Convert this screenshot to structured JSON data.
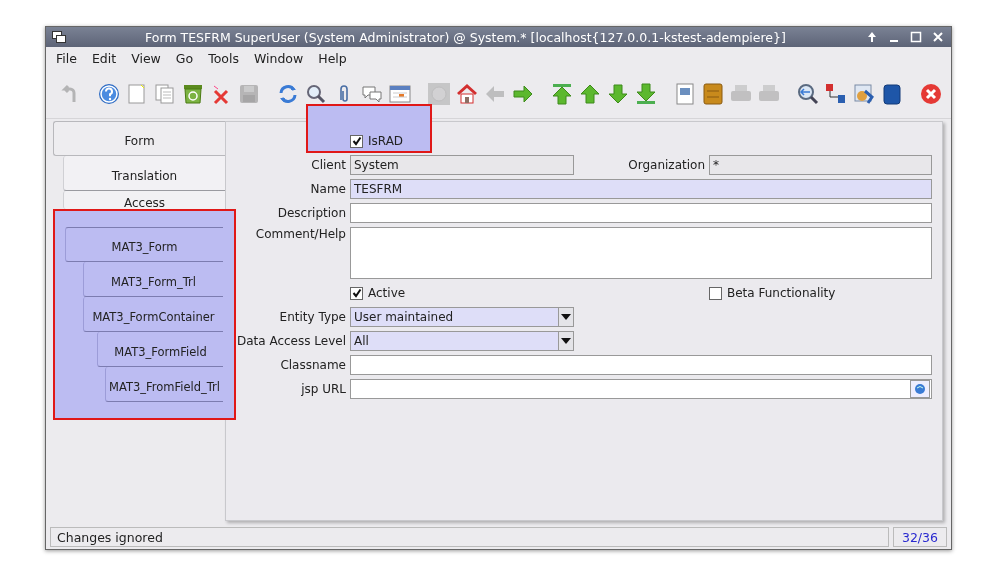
{
  "window": {
    "title": "Form  TESFRM  SuperUser (System Administrator) @ System.* [localhost{127.0.0.1-kstest-adempiere}]"
  },
  "menu": [
    "File",
    "Edit",
    "View",
    "Go",
    "Tools",
    "Window",
    "Help"
  ],
  "toolbar": [
    {
      "kind": "undo",
      "disabled": true,
      "group_start": false
    },
    {
      "kind": "help",
      "disabled": false,
      "group_start": true
    },
    {
      "kind": "new",
      "disabled": false,
      "group_start": false
    },
    {
      "kind": "copy",
      "disabled": false,
      "group_start": false
    },
    {
      "kind": "recycle",
      "disabled": false,
      "group_start": false
    },
    {
      "kind": "delete",
      "disabled": false,
      "group_start": false
    },
    {
      "kind": "save",
      "disabled": true,
      "group_start": false
    },
    {
      "kind": "refresh",
      "disabled": false,
      "group_start": true
    },
    {
      "kind": "search",
      "disabled": false,
      "group_start": false
    },
    {
      "kind": "attach",
      "disabled": false,
      "group_start": false
    },
    {
      "kind": "chat",
      "disabled": false,
      "group_start": false
    },
    {
      "kind": "calendar",
      "disabled": false,
      "group_start": false
    },
    {
      "kind": "history",
      "disabled": true,
      "group_start": true
    },
    {
      "kind": "home",
      "disabled": false,
      "group_start": false
    },
    {
      "kind": "back",
      "disabled": true,
      "group_start": false
    },
    {
      "kind": "forward",
      "disabled": false,
      "group_start": false
    },
    {
      "kind": "first",
      "disabled": false,
      "group_start": true
    },
    {
      "kind": "up",
      "disabled": false,
      "group_start": false
    },
    {
      "kind": "down",
      "disabled": false,
      "group_start": false
    },
    {
      "kind": "last",
      "disabled": false,
      "group_start": false
    },
    {
      "kind": "report",
      "disabled": false,
      "group_start": true
    },
    {
      "kind": "archive",
      "disabled": false,
      "group_start": false
    },
    {
      "kind": "print",
      "disabled": true,
      "group_start": false
    },
    {
      "kind": "print",
      "disabled": true,
      "group_start": false
    },
    {
      "kind": "zoom",
      "disabled": false,
      "group_start": true
    },
    {
      "kind": "workflow",
      "disabled": false,
      "group_start": false
    },
    {
      "kind": "process",
      "disabled": false,
      "group_start": false
    },
    {
      "kind": "database",
      "disabled": false,
      "group_start": false
    },
    {
      "kind": "close",
      "disabled": false,
      "group_start": true
    }
  ],
  "tabs": [
    {
      "label": "Form",
      "selected": true,
      "highlighted": false,
      "children": [
        {
          "label": "Translation",
          "selected": false,
          "highlighted": false
        },
        {
          "label": "Access",
          "selected": false,
          "highlighted": false
        },
        {
          "label": "MAT3_Form",
          "selected": false,
          "highlighted": true,
          "children": [
            {
              "label": "MAT3_Form_Trl",
              "selected": false,
              "highlighted": false
            },
            {
              "label": "MAT3_FormContainer",
              "selected": false,
              "highlighted": false,
              "children": [
                {
                  "label": "MAT3_FormField",
                  "selected": false,
                  "highlighted": false,
                  "children": [
                    {
                      "label": "MAT3_FromField_Trl",
                      "selected": false,
                      "highlighted": false
                    }
                  ]
                }
              ]
            }
          ]
        }
      ]
    }
  ],
  "form_rows": [
    [
      {
        "kind": "checkbox",
        "label": "IsRAD",
        "checked": true,
        "highlighted": true
      }
    ],
    [
      {
        "kind": "text",
        "label": "Client",
        "value": "System",
        "mandatory": false,
        "readonly": true,
        "wide": false
      },
      {
        "kind": "text",
        "label": "Organization",
        "value": "*",
        "mandatory": false,
        "readonly": true,
        "wide": false
      }
    ],
    [
      {
        "kind": "text",
        "label": "Name",
        "value": "TESFRM",
        "mandatory": true,
        "wide": true
      }
    ],
    [
      {
        "kind": "text",
        "label": "Description",
        "mandatory": false,
        "readonly": false,
        "wide": true
      }
    ],
    [
      {
        "kind": "textarea",
        "label": "Comment/Help",
        "wide": true
      }
    ],
    [
      {
        "kind": "checkbox",
        "label": "Active",
        "checked": true,
        "highlighted": false
      },
      {
        "kind": "checkbox",
        "label": "Beta Functionality",
        "checked": false,
        "highlighted": false
      }
    ],
    [
      {
        "kind": "select",
        "label": "Entity Type",
        "value": "User maintained"
      }
    ],
    [
      {
        "kind": "select",
        "label": "Data Access Level",
        "value": "All"
      }
    ],
    [
      {
        "kind": "text",
        "label": "Classname",
        "mandatory": false,
        "readonly": false,
        "wide": true
      }
    ],
    [
      {
        "kind": "url",
        "label": "jsp URL",
        "wide": true
      }
    ]
  ],
  "status_bar": {
    "message": "Changes ignored",
    "record": "32/36"
  }
}
